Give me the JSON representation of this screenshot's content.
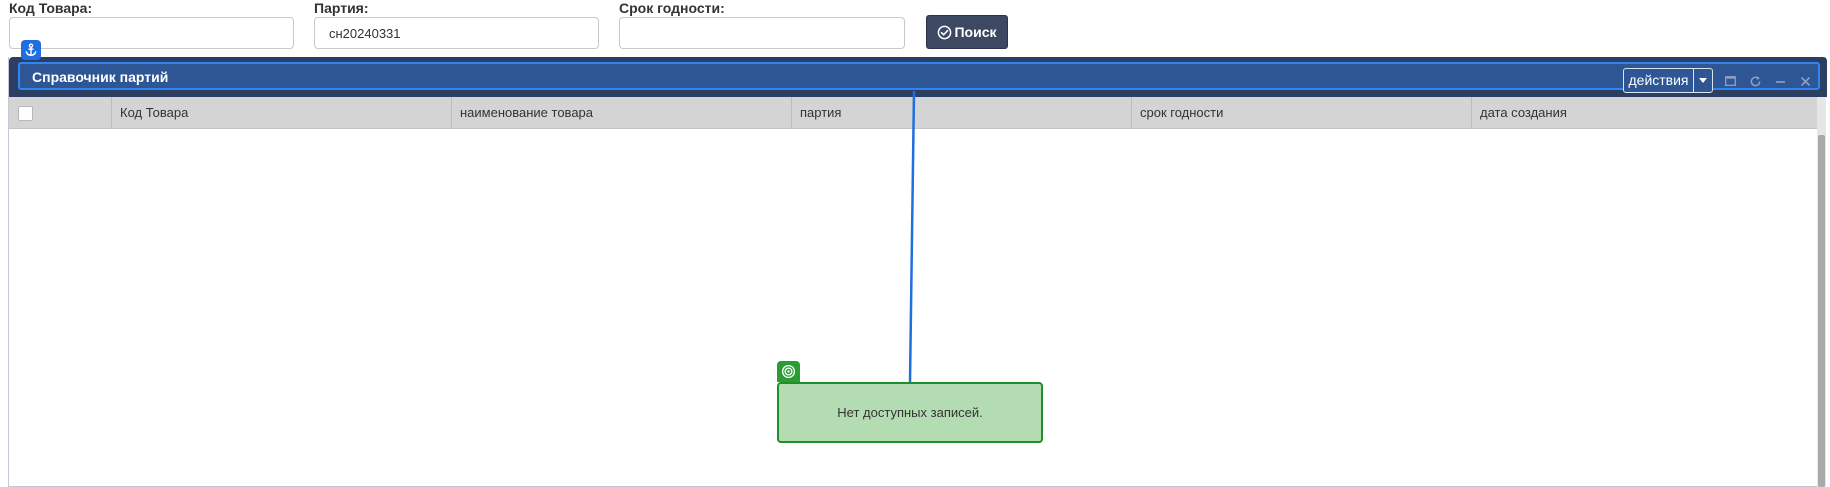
{
  "filters": {
    "product_code_label": "Код Товара:",
    "product_code_value": "",
    "batch_label": "Партия:",
    "batch_value": "сн20240331",
    "expiry_label": "Срок годности:",
    "expiry_value": "",
    "search_button_label": "Поиск"
  },
  "panel": {
    "title": "Справочник партий",
    "actions_label": "действия",
    "header_icons": [
      "maximize-icon",
      "refresh-icon",
      "minimize-icon",
      "close-icon"
    ]
  },
  "grid": {
    "columns": [
      "Код Товара",
      "наименование товара",
      "партия",
      "срок годности",
      "дата создания"
    ],
    "empty_message": "Нет доступных записей."
  },
  "colors": {
    "header_bg": "#2d3e63",
    "header_highlight": "#2f86f3",
    "search_button_bg": "#3d4862",
    "empty_box_bg": "#b4dcb3",
    "empty_box_border": "#1e8f29",
    "connector_line": "#1f6fe0"
  }
}
